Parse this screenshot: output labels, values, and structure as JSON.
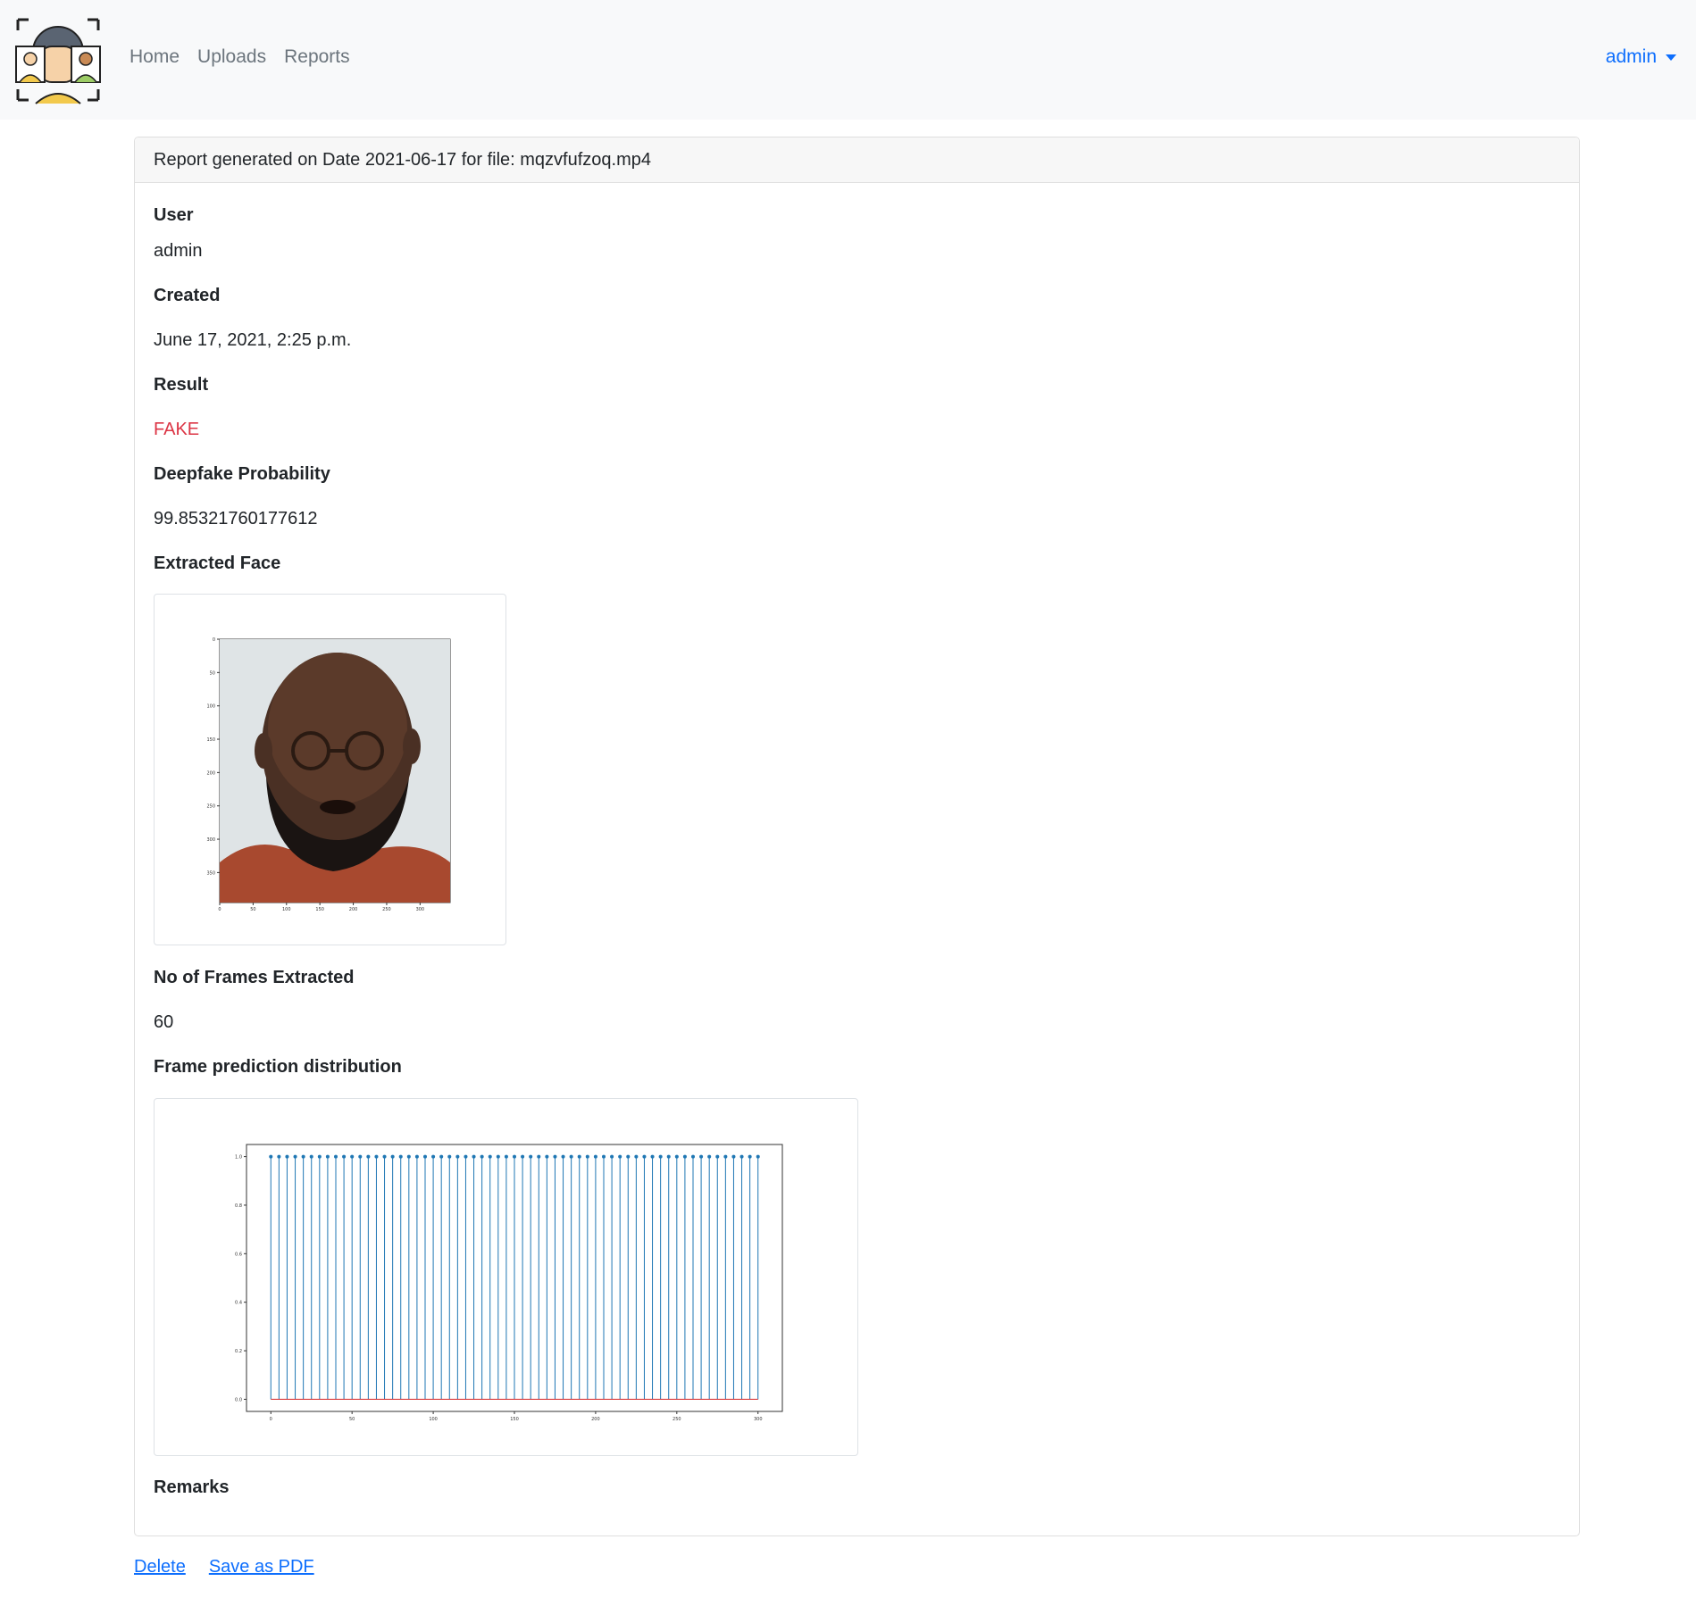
{
  "navbar": {
    "links": [
      "Home",
      "Uploads",
      "Reports"
    ],
    "user": "admin"
  },
  "report": {
    "header": "Report generated on Date 2021-06-17 for file: mqzvfufzoq.mp4",
    "user_label": "User",
    "user_value": "admin",
    "created_label": "Created",
    "created_value": "June 17, 2021, 2:25 p.m.",
    "result_label": "Result",
    "result_value": "FAKE",
    "probability_label": "Deepfake Probability",
    "probability_value": "99.85321760177612",
    "face_label": "Extracted Face",
    "frames_label": "No of Frames Extracted",
    "frames_value": "60",
    "distribution_label": "Frame prediction distribution",
    "remarks_label": "Remarks"
  },
  "footer": {
    "delete": "Delete",
    "save_pdf": "Save as PDF"
  },
  "colors": {
    "fake": "#dc3545",
    "link": "#0d6efd",
    "stem": "#1f77b4",
    "baseline": "#d62728"
  },
  "face_plot": {
    "x_ticks": [
      "0",
      "50",
      "100",
      "150",
      "200",
      "250",
      "300"
    ],
    "y_ticks": [
      "0",
      "50",
      "100",
      "150",
      "200",
      "250",
      "300",
      "350"
    ]
  },
  "chart_data": {
    "type": "stem",
    "x_ticks": [
      "0",
      "50",
      "100",
      "150",
      "200",
      "250",
      "300"
    ],
    "y_ticks": [
      "0.0",
      "0.2",
      "0.4",
      "0.6",
      "0.8",
      "1.0"
    ],
    "xlim": [
      -15,
      315
    ],
    "ylim": [
      -0.05,
      1.05
    ],
    "x": [
      0,
      5,
      10,
      15,
      20,
      25,
      30,
      35,
      40,
      45,
      50,
      55,
      60,
      65,
      70,
      75,
      80,
      85,
      90,
      95,
      100,
      105,
      110,
      115,
      120,
      125,
      130,
      135,
      140,
      145,
      150,
      155,
      160,
      165,
      170,
      175,
      180,
      185,
      190,
      195,
      200,
      205,
      210,
      215,
      220,
      225,
      230,
      235,
      240,
      245,
      250,
      255,
      260,
      265,
      270,
      275,
      280,
      285,
      290,
      295,
      300
    ],
    "values": [
      1,
      1,
      1,
      1,
      1,
      1,
      1,
      1,
      1,
      1,
      1,
      1,
      1,
      1,
      1,
      1,
      1,
      1,
      1,
      1,
      1,
      1,
      1,
      1,
      1,
      1,
      1,
      1,
      1,
      1,
      1,
      1,
      1,
      1,
      1,
      1,
      1,
      1,
      1,
      1,
      1,
      1,
      1,
      1,
      1,
      1,
      1,
      1,
      1,
      1,
      1,
      1,
      1,
      1,
      1,
      1,
      1,
      1,
      1,
      1,
      1
    ],
    "baseline": 0
  }
}
